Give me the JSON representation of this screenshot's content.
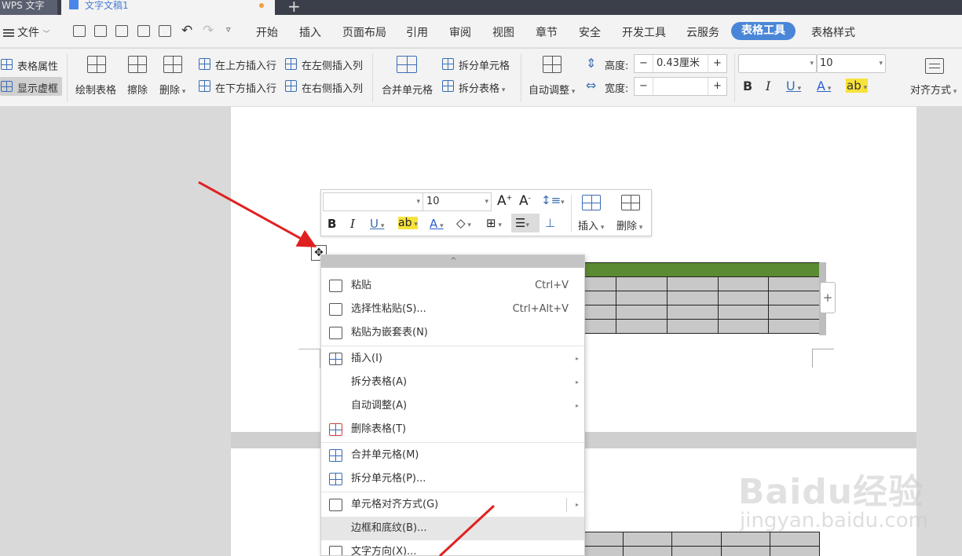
{
  "titlebar": {
    "app_tab": "WPS 文字",
    "doc_tab": "文字文稿1",
    "add_tab": "+"
  },
  "menubar": {
    "file": "文件",
    "items": [
      "开始",
      "插入",
      "页面布局",
      "引用",
      "审阅",
      "视图",
      "章节",
      "安全",
      "开发工具",
      "云服务"
    ],
    "active": "表格工具",
    "after_active": "表格样式"
  },
  "ribbon": {
    "table_props": "表格属性",
    "show_grid": "显示虚框",
    "draw_table": "绘制表格",
    "erase": "擦除",
    "delete": "删除",
    "insert_above": "在上方插入行",
    "insert_below": "在下方插入行",
    "insert_left": "在左侧插入列",
    "insert_right": "在右侧插入列",
    "merge_cells": "合并单元格",
    "split_cells": "拆分单元格",
    "split_table": "拆分表格",
    "auto_adjust": "自动调整",
    "height_label": "高度:",
    "height_value": "0.43厘米",
    "width_label": "宽度:",
    "width_value": "",
    "font_name": "",
    "font_size": "10",
    "align": "对齐方式"
  },
  "mini_toolbar": {
    "font_name": "",
    "font_size": "10",
    "insert": "插入",
    "delete": "删除"
  },
  "context_menu": {
    "top_glyph": "^",
    "items": [
      {
        "label": "粘贴",
        "shortcut": "Ctrl+V",
        "icon": "paste-icon"
      },
      {
        "label": "选择性粘贴(S)...",
        "shortcut": "Ctrl+Alt+V",
        "icon": "paste-special-icon"
      },
      {
        "label": "粘贴为嵌套表(N)",
        "shortcut": "",
        "icon": "paste-nested-icon"
      },
      {
        "label": "插入(I)",
        "shortcut": "",
        "icon": "insert-table-icon",
        "submenu": true
      },
      {
        "label": "拆分表格(A)",
        "shortcut": "",
        "icon": "",
        "submenu": true
      },
      {
        "label": "自动调整(A)",
        "shortcut": "",
        "icon": "",
        "submenu": true
      },
      {
        "label": "删除表格(T)",
        "shortcut": "",
        "icon": "delete-table-icon"
      },
      {
        "label": "合并单元格(M)",
        "shortcut": "",
        "icon": "merge-cells-icon"
      },
      {
        "label": "拆分单元格(P)...",
        "shortcut": "",
        "icon": "split-cells-icon"
      },
      {
        "label": "单元格对齐方式(G)",
        "shortcut": "",
        "icon": "cell-align-icon",
        "submenu": true
      },
      {
        "label": "边框和底纹(B)...",
        "shortcut": "",
        "icon": "",
        "highlighted": true
      },
      {
        "label": "文字方向(X)...",
        "shortcut": "",
        "icon": "text-direction-icon"
      }
    ]
  },
  "document": {
    "add_column": "+"
  },
  "watermark": {
    "main": "Baidu经验",
    "sub": "jingyan.baidu.com"
  },
  "colors": {
    "accent": "#4a86d8",
    "table_header": "#5a8a32",
    "table_cell": "#c8c8c8",
    "arrow": "#e02020"
  }
}
